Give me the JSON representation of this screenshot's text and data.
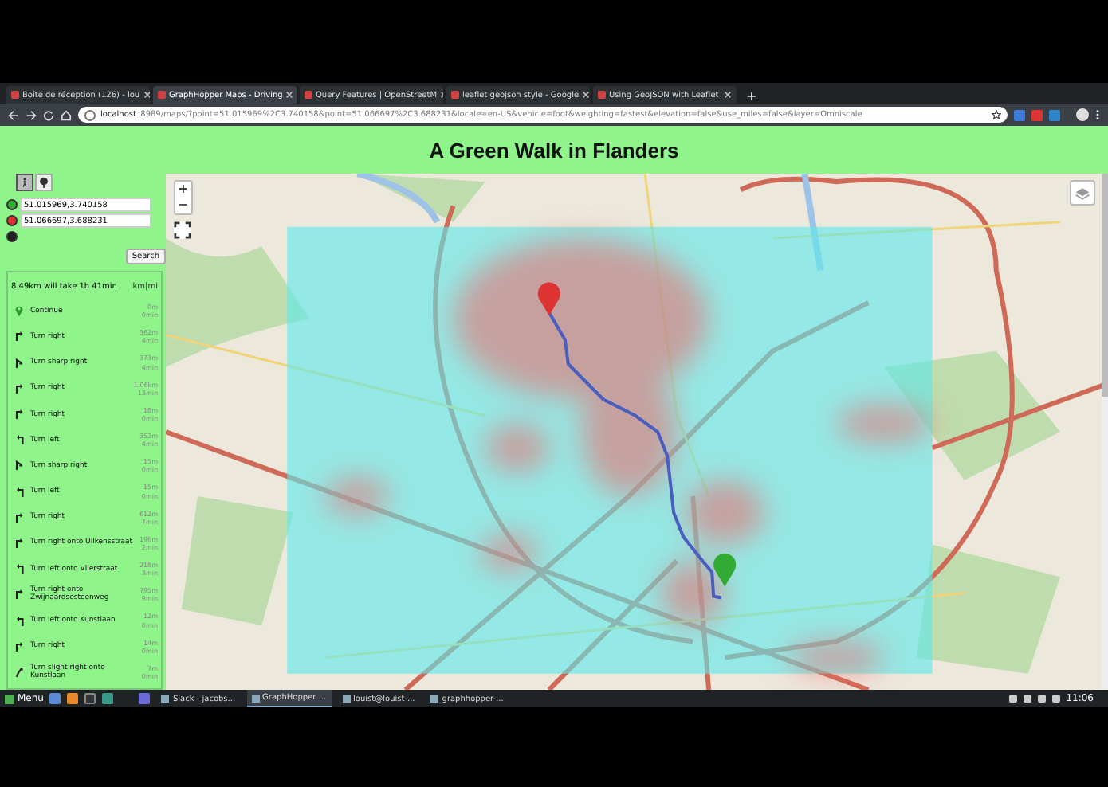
{
  "browser": {
    "tabs": [
      {
        "title": "Boîte de réception (126) - lou",
        "selected": false
      },
      {
        "title": "GraphHopper Maps - Driving",
        "selected": true
      },
      {
        "title": "Query Features | OpenStreetM",
        "selected": false
      },
      {
        "title": "leaflet geojson style - Google",
        "selected": false
      },
      {
        "title": "Using GeoJSON with Leaflet",
        "selected": false
      }
    ],
    "new_tab": "+",
    "url_host": "localhost",
    "url_rest": ":8989/maps/?point=51.015969%2C3.740158&point=51.066697%2C3.688231&locale=en-US&vehicle=foot&weighting=fastest&elevation=false&use_miles=false&layer=Omniscale"
  },
  "page": {
    "title": "A Green Walk in Flanders",
    "vehicles": [
      {
        "kind": "foot",
        "selected": true
      },
      {
        "kind": "tree",
        "selected": false
      }
    ],
    "points": [
      {
        "kind": "start",
        "value": "51.015969,3.740158"
      },
      {
        "kind": "end",
        "value": "51.066697,3.688231"
      },
      {
        "kind": "via"
      }
    ],
    "search_button": "Search",
    "summary": "8.49km will take 1h 41min",
    "units": "km|mi",
    "instructions": [
      {
        "kind": "continue",
        "text": "Continue",
        "distance": "0m",
        "time": "0min"
      },
      {
        "kind": "right",
        "text": "Turn right",
        "distance": "362m",
        "time": "4min"
      },
      {
        "kind": "sharp_right",
        "text": "Turn sharp right",
        "distance": "373m",
        "time": "4min"
      },
      {
        "kind": "right",
        "text": "Turn right",
        "distance": "1.06km",
        "time": "13min"
      },
      {
        "kind": "right",
        "text": "Turn right",
        "distance": "18m",
        "time": "0min"
      },
      {
        "kind": "left",
        "text": "Turn left",
        "distance": "352m",
        "time": "4min"
      },
      {
        "kind": "sharp_right",
        "text": "Turn sharp right",
        "distance": "15m",
        "time": "0min"
      },
      {
        "kind": "left",
        "text": "Turn left",
        "distance": "15m",
        "time": "0min"
      },
      {
        "kind": "right",
        "text": "Turn right",
        "distance": "612m",
        "time": "7min"
      },
      {
        "kind": "right",
        "text": "Turn right onto Uilkensstraat",
        "distance": "196m",
        "time": "2min"
      },
      {
        "kind": "left",
        "text": "Turn left onto Vlierstraat",
        "distance": "218m",
        "time": "3min"
      },
      {
        "kind": "right",
        "text": "Turn right onto Zwijnaardsesteenweg",
        "distance": "795m",
        "time": "9min"
      },
      {
        "kind": "left",
        "text": "Turn left onto Kunstlaan",
        "distance": "12m",
        "time": "0min"
      },
      {
        "kind": "right",
        "text": "Turn right",
        "distance": "14m",
        "time": "0min"
      },
      {
        "kind": "slight_right",
        "text": "Turn slight right onto Kunstlaan",
        "distance": "7m",
        "time": "0min"
      }
    ],
    "map_controls": {
      "zoom_in": "+",
      "zoom_out": "−"
    }
  },
  "taskbar": {
    "menu": "Menu",
    "windows": [
      {
        "title": "Slack - jacobs...",
        "selected": false
      },
      {
        "title": "GraphHopper ...",
        "selected": true
      },
      {
        "title": "louist@louist-...",
        "selected": false
      },
      {
        "title": "graphhopper-...",
        "selected": false
      }
    ],
    "clock": "11:06"
  }
}
